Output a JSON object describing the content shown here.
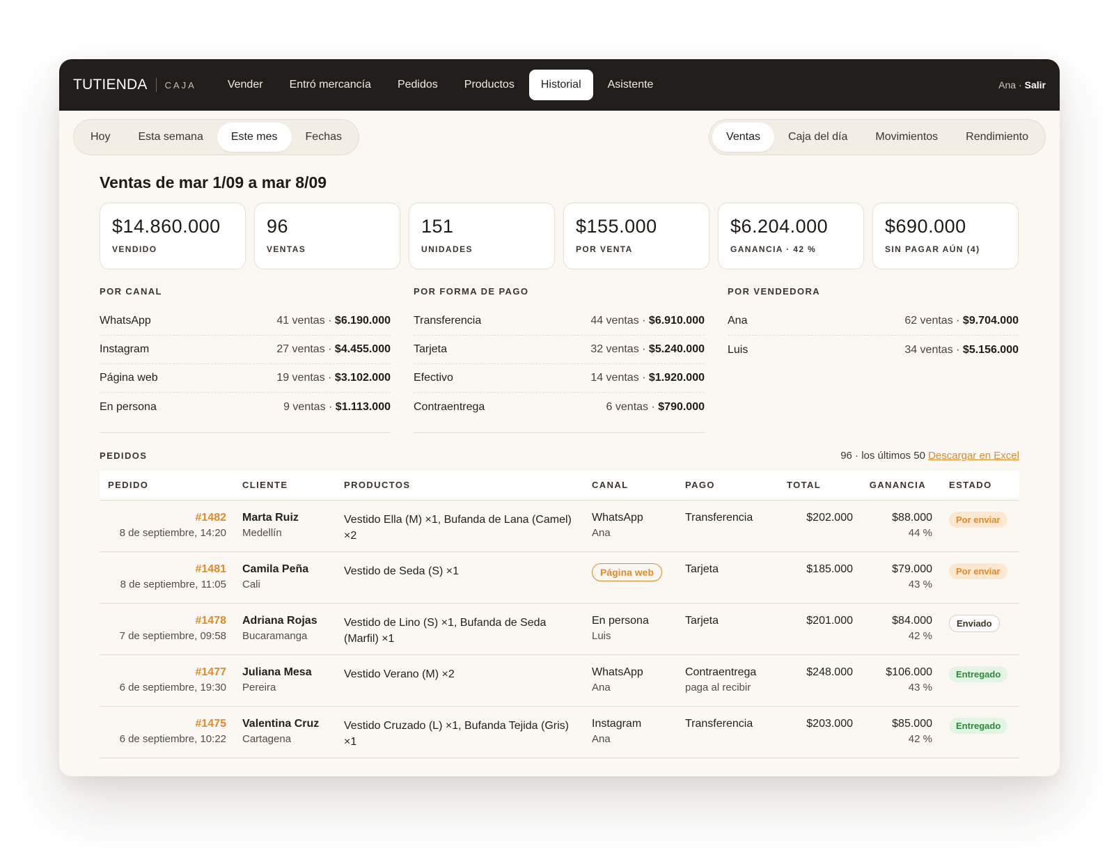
{
  "app": {
    "brand": "TUTIENDA",
    "brand_sub": "CAJA"
  },
  "nav": [
    {
      "label": "Vender",
      "active": false
    },
    {
      "label": "Entró mercancía",
      "active": false
    },
    {
      "label": "Pedidos",
      "active": false
    },
    {
      "label": "Productos",
      "active": false
    },
    {
      "label": "Historial",
      "active": true
    },
    {
      "label": "Asistente",
      "active": false
    }
  ],
  "user": {
    "name": "Ana ·",
    "logout": "Salir"
  },
  "period_tabs": [
    {
      "label": "Hoy",
      "active": false
    },
    {
      "label": "Esta semana",
      "active": false
    },
    {
      "label": "Este mes",
      "active": true
    },
    {
      "label": "Fechas",
      "active": false
    }
  ],
  "view_tabs": [
    {
      "label": "Ventas",
      "active": true
    },
    {
      "label": "Caja del día",
      "active": false
    },
    {
      "label": "Movimientos",
      "active": false
    },
    {
      "label": "Rendimiento",
      "active": false
    }
  ],
  "page_title": "Ventas de mar 1/09 a mar 8/09",
  "kpis": [
    {
      "value": "$14.860.000",
      "label": "VENDIDO"
    },
    {
      "value": "96",
      "label": "VENTAS"
    },
    {
      "value": "151",
      "label": "UNIDADES"
    },
    {
      "value": "$155.000",
      "label": "POR VENTA"
    },
    {
      "value": "$6.204.000",
      "label": "GANANCIA · 42 %"
    },
    {
      "value": "$690.000",
      "label": "SIN PAGAR AÚN (4)"
    }
  ],
  "breakdowns": [
    {
      "title": "POR CANAL",
      "rows": [
        {
          "name": "WhatsApp",
          "count": "41 ventas ·",
          "amount": "$6.190.000"
        },
        {
          "name": "Instagram",
          "count": "27 ventas ·",
          "amount": "$4.455.000"
        },
        {
          "name": "Página web",
          "count": "19 ventas ·",
          "amount": "$3.102.000"
        },
        {
          "name": "En persona",
          "count": "9 ventas ·",
          "amount": "$1.113.000"
        }
      ]
    },
    {
      "title": "POR FORMA DE PAGO",
      "rows": [
        {
          "name": "Transferencia",
          "count": "44 ventas ·",
          "amount": "$6.910.000"
        },
        {
          "name": "Tarjeta",
          "count": "32 ventas ·",
          "amount": "$5.240.000"
        },
        {
          "name": "Efectivo",
          "count": "14 ventas ·",
          "amount": "$1.920.000"
        },
        {
          "name": "Contraentrega",
          "count": "6 ventas ·",
          "amount": "$790.000"
        }
      ]
    },
    {
      "title": "POR VENDEDORA",
      "rows": [
        {
          "name": "Ana",
          "count": "62 ventas ·",
          "amount": "$9.704.000"
        },
        {
          "name": "Luis",
          "count": "34 ventas ·",
          "amount": "$5.156.000"
        }
      ]
    }
  ],
  "orders": {
    "title": "PEDIDOS",
    "summary": "96 · los últimos 50",
    "excel_link": "Descargar en Excel",
    "columns": [
      "PEDIDO",
      "CLIENTE",
      "PRODUCTOS",
      "CANAL",
      "PAGO",
      "TOTAL",
      "GANANCIA",
      "ESTADO"
    ],
    "rows": [
      {
        "id": "#1482",
        "date": "8 de septiembre, 14:20",
        "client": "Marta Ruiz",
        "city": "Medellín",
        "products": "Vestido Ella (M) ×1, Bufanda de Lana (Camel) ×2",
        "channel": "WhatsApp",
        "channel_badge": false,
        "seller": "Ana",
        "payment": "Transferencia",
        "payment_note": "",
        "total": "$202.000",
        "profit": "$88.000",
        "margin": "44 %",
        "status": "Por enviar",
        "status_type": "por-enviar"
      },
      {
        "id": "#1481",
        "date": "8 de septiembre, 11:05",
        "client": "Camila Peña",
        "city": "Cali",
        "products": "Vestido de Seda (S) ×1",
        "channel": "Página web",
        "channel_badge": true,
        "seller": "",
        "payment": "Tarjeta",
        "payment_note": "",
        "total": "$185.000",
        "profit": "$79.000",
        "margin": "43 %",
        "status": "Por enviar",
        "status_type": "por-enviar"
      },
      {
        "id": "#1478",
        "date": "7 de septiembre, 09:58",
        "client": "Adriana Rojas",
        "city": "Bucaramanga",
        "products": "Vestido de Lino (S) ×1, Bufanda de Seda (Marfil) ×1",
        "channel": "En persona",
        "channel_badge": false,
        "seller": "Luis",
        "payment": "Tarjeta",
        "payment_note": "",
        "total": "$201.000",
        "profit": "$84.000",
        "margin": "42 %",
        "status": "Enviado",
        "status_type": "enviado"
      },
      {
        "id": "#1477",
        "date": "6 de septiembre, 19:30",
        "client": "Juliana Mesa",
        "city": "Pereira",
        "products": "Vestido Verano (M) ×2",
        "channel": "WhatsApp",
        "channel_badge": false,
        "seller": "Ana",
        "payment": "Contraentrega",
        "payment_note": "paga al recibir",
        "total": "$248.000",
        "profit": "$106.000",
        "margin": "43 %",
        "status": "Entregado",
        "status_type": "entregado"
      },
      {
        "id": "#1475",
        "date": "6 de septiembre, 10:22",
        "client": "Valentina Cruz",
        "city": "Cartagena",
        "products": "Vestido Cruzado (L) ×1, Bufanda Tejida (Gris) ×1",
        "channel": "Instagram",
        "channel_badge": false,
        "seller": "Ana",
        "payment": "Transferencia",
        "payment_note": "",
        "total": "$203.000",
        "profit": "$85.000",
        "margin": "42 %",
        "status": "Entregado",
        "status_type": "entregado"
      }
    ]
  },
  "colors": {
    "accent": "#e38a2a",
    "topbar": "#211d1a",
    "background": "#fbf8f3",
    "success": "#2d8a3a"
  }
}
